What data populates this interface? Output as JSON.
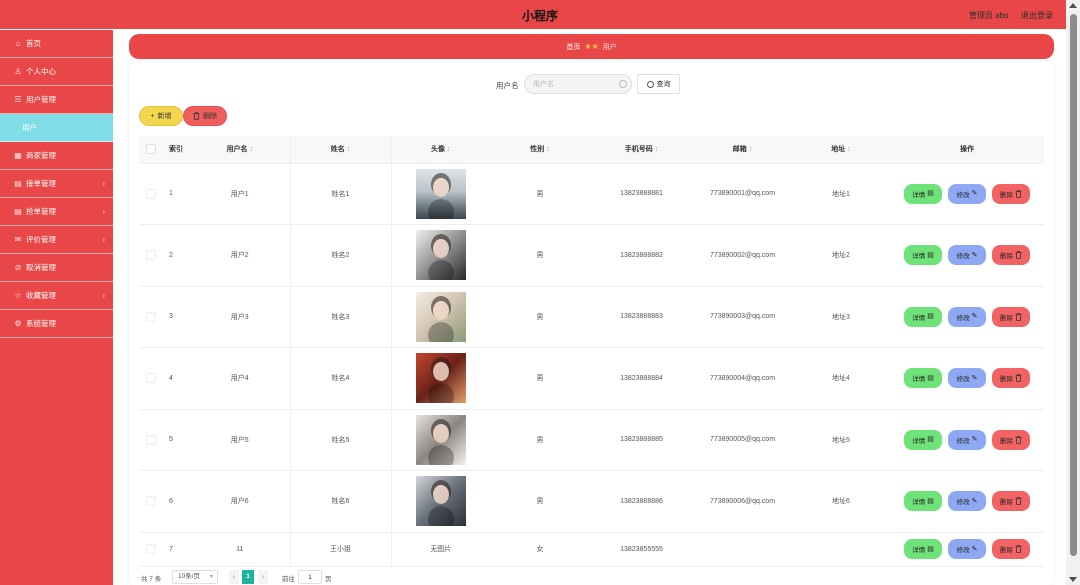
{
  "header": {
    "title": "小程序",
    "admin": "管理员 abo",
    "logout": "退出登录"
  },
  "sidebar": {
    "items": [
      {
        "label": "首页",
        "icon": "home-icon"
      },
      {
        "label": "个人中心",
        "icon": "user-icon"
      },
      {
        "label": "用户管理",
        "icon": "users-icon"
      },
      {
        "label": "用户",
        "active": true
      },
      {
        "label": "商家管理",
        "icon": "shop-icon"
      },
      {
        "label": "接单管理",
        "icon": "order-icon",
        "expandable": true
      },
      {
        "label": "抢单管理",
        "icon": "order-icon",
        "expandable": true
      },
      {
        "label": "评价管理",
        "icon": "comment-icon",
        "expandable": true
      },
      {
        "label": "取消管理",
        "icon": "cancel-icon"
      },
      {
        "label": "收藏管理",
        "icon": "favorite-icon",
        "expandable": true
      },
      {
        "label": "系统管理",
        "icon": "settings-icon"
      }
    ]
  },
  "breadcrumb": {
    "home": "首页",
    "separator_icon": "star-icon",
    "current": "用户"
  },
  "search": {
    "label": "用户名",
    "placeholder": "用户名",
    "value": "",
    "button": "查询",
    "button_icon": "search-icon"
  },
  "toolbar": {
    "add": "新增",
    "add_icon": "plus-icon",
    "delete": "删除",
    "delete_icon": "trash-icon"
  },
  "table": {
    "columns": [
      {
        "label": "索引",
        "sortable": false
      },
      {
        "label": "用户名",
        "sortable": true
      },
      {
        "label": "姓名",
        "sortable": true
      },
      {
        "label": "头像",
        "sortable": true
      },
      {
        "label": "性别",
        "sortable": true
      },
      {
        "label": "手机号码",
        "sortable": true
      },
      {
        "label": "邮箱",
        "sortable": true
      },
      {
        "label": "地址",
        "sortable": true
      },
      {
        "label": "操作",
        "sortable": false
      }
    ],
    "rows": [
      {
        "index": "1",
        "username": "用户1",
        "name": "姓名1",
        "has_avatar": true,
        "sex": "男",
        "phone": "13823888881",
        "email": "773890001@qq.com",
        "address": "地址1"
      },
      {
        "index": "2",
        "username": "用户2",
        "name": "姓名2",
        "has_avatar": true,
        "sex": "男",
        "phone": "13823888882",
        "email": "773890002@qq.com",
        "address": "地址2"
      },
      {
        "index": "3",
        "username": "用户3",
        "name": "姓名3",
        "has_avatar": true,
        "sex": "男",
        "phone": "13823888883",
        "email": "773890003@qq.com",
        "address": "地址3"
      },
      {
        "index": "4",
        "username": "用户4",
        "name": "姓名4",
        "has_avatar": true,
        "sex": "男",
        "phone": "13823888884",
        "email": "773890004@qq.com",
        "address": "地址4"
      },
      {
        "index": "5",
        "username": "用户5",
        "name": "姓名5",
        "has_avatar": true,
        "sex": "男",
        "phone": "13823888885",
        "email": "773890005@qq.com",
        "address": "地址5"
      },
      {
        "index": "6",
        "username": "用户6",
        "name": "姓名6",
        "has_avatar": true,
        "sex": "男",
        "phone": "13823888886",
        "email": "773890006@qq.com",
        "address": "地址6"
      },
      {
        "index": "7",
        "username": "11",
        "name": "王小姐",
        "has_avatar": false,
        "avatar_text": "无图片",
        "sex": "女",
        "phone": "13823855555",
        "email": "",
        "address": ""
      }
    ],
    "actions": {
      "detail": "详情",
      "edit": "修改",
      "delete": "删除"
    }
  },
  "pagination": {
    "total": "共 7 条",
    "page_size": "10条/页",
    "current_page": "1",
    "goto_label": "前往",
    "goto_value": "1",
    "page_unit": "页"
  },
  "colors": {
    "primary": "#E94747",
    "active_menu": "#80DCE5",
    "add_button": "#F1D64E",
    "delete_button": "#EF5E5E",
    "detail_button": "#6FE27A",
    "edit_button": "#8EA8F3",
    "page_active": "#1DB39C"
  }
}
